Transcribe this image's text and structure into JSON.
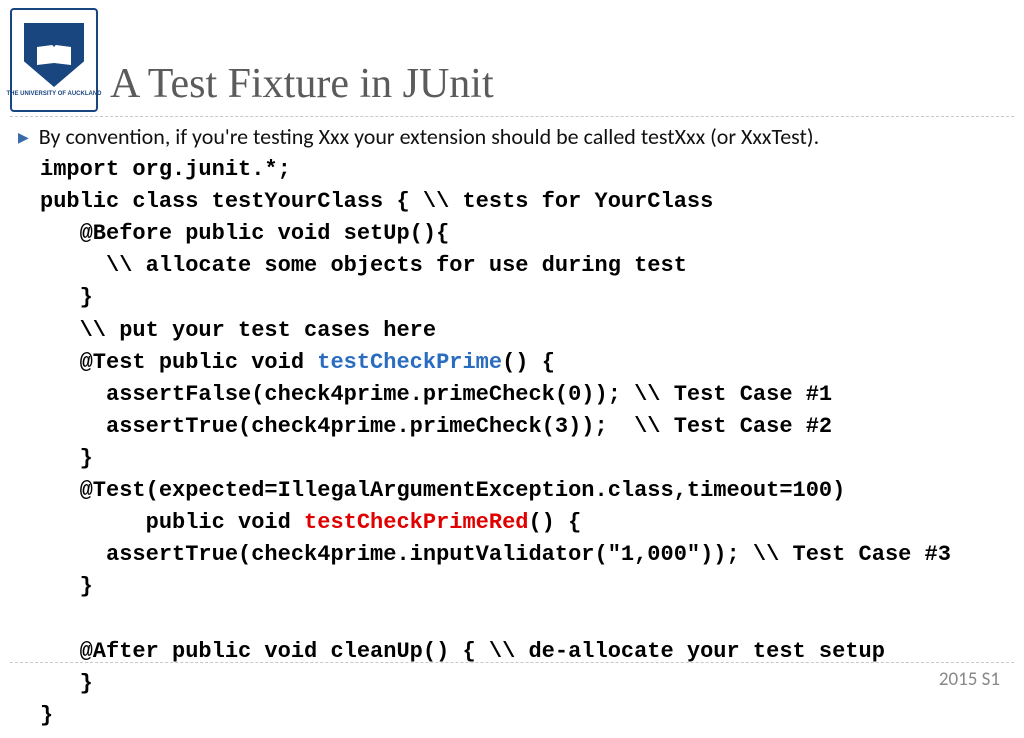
{
  "header": {
    "logo_text": "THE UNIVERSITY OF AUCKLAND",
    "title": "A Test Fixture in JUnit"
  },
  "bullet": "By convention, if you're testing Xxx your extension should be called testXxx (or XxxTest).",
  "code": {
    "l01": "import org.junit.*;",
    "l02": "public class testYourClass { \\\\ tests for YourClass",
    "l03": "   @Before public void setUp(){",
    "l04": "     \\\\ allocate some objects for use during test",
    "l05": "   }",
    "l06": "   \\\\ put your test cases here",
    "l07a": "   @Test public void ",
    "l07b": "testCheckPrime",
    "l07c": "() {",
    "l08": "     assertFalse(check4prime.primeCheck(0)); \\\\ Test Case #1",
    "l09": "     assertTrue(check4prime.primeCheck(3));  \\\\ Test Case #2",
    "l10": "   }",
    "l11": "   @Test(expected=IllegalArgumentException.class,timeout=100)",
    "l12a": "        public void ",
    "l12b": "testCheckPrimeRed",
    "l12c": "() {",
    "l13": "     assertTrue(check4prime.inputValidator(\"1,000\")); \\\\ Test Case #3",
    "l14": "   }",
    "l15": "",
    "l16": "   @After public void cleanUp() { \\\\ de-allocate your test setup",
    "l17": "   }",
    "l18": "}"
  },
  "footer": "2015 S1"
}
